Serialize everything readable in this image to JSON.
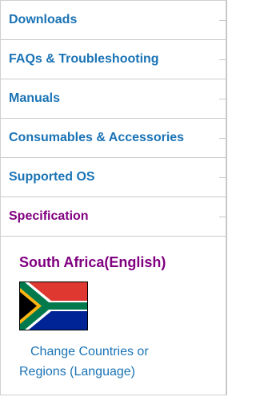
{
  "nav": {
    "items": [
      {
        "label": "Downloads"
      },
      {
        "label": "FAQs & Troubleshooting"
      },
      {
        "label": "Manuals"
      },
      {
        "label": "Consumables & Accessories"
      },
      {
        "label": "Supported OS"
      },
      {
        "label": "Specification"
      }
    ]
  },
  "region": {
    "current": "South Africa(English)",
    "change_link": "Change Countries or Regions (Language)"
  },
  "colors": {
    "link": "#1a73b5",
    "active": "#800080"
  }
}
